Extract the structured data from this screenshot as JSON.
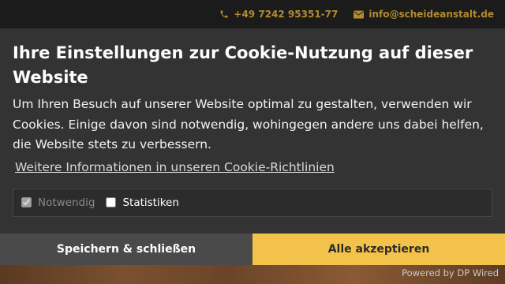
{
  "topbar": {
    "phone": "+49 7242 95351-77",
    "email": "info@scheideanstalt.de"
  },
  "banner": {
    "title": "Ihre Einstellungen zur Cookie-Nutzung auf dieser Website",
    "description": "Um Ihren Besuch auf unserer Website optimal zu gestalten, verwenden wir Cookies. Einige davon sind notwendig, wohingegen andere uns dabei helfen, die Website stets zu verbessern.",
    "policy_link": "Weitere Informationen in unseren Cookie-Richtlinien",
    "options": {
      "necessary_label": "Notwendig",
      "statistics_label": "Statistiken"
    }
  },
  "buttons": {
    "save": "Speichern & schließen",
    "accept_all": "Alle akzeptieren"
  },
  "footer": {
    "powered_by": "Powered by DP Wired"
  },
  "colors": {
    "accent": "#f3c24a",
    "topbar_text": "#b48a2e",
    "banner_bg": "#333333"
  },
  "icons": [
    "phone-icon",
    "envelope-icon"
  ]
}
